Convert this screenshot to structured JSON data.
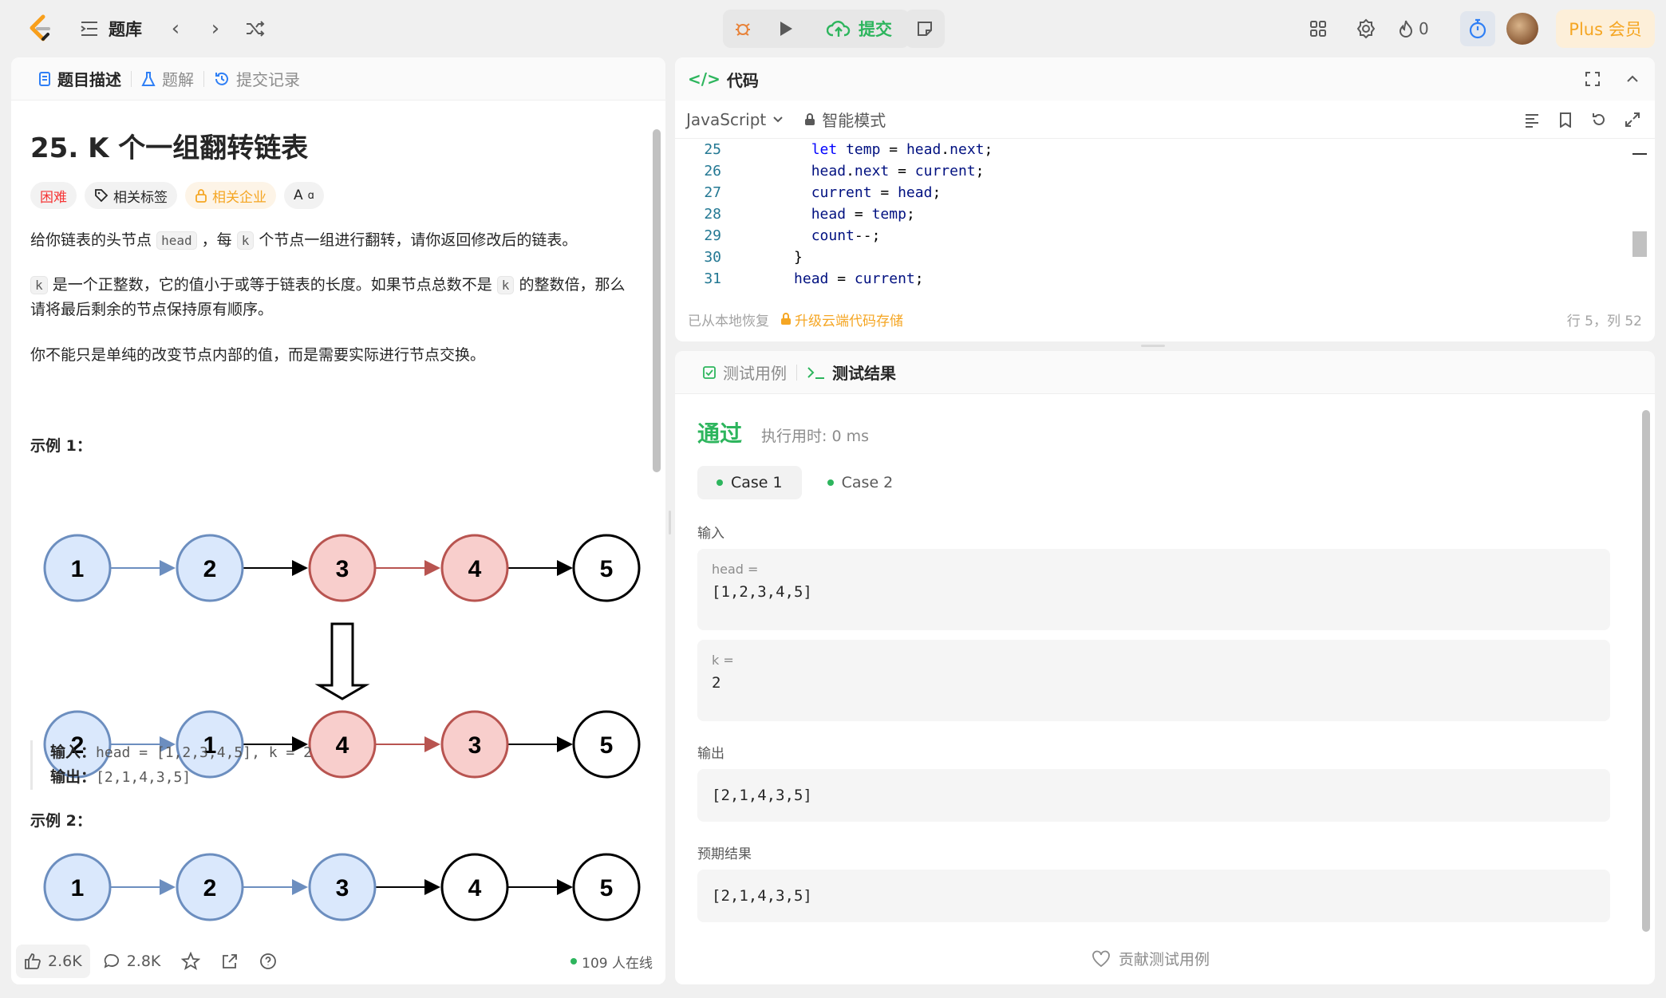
{
  "topbar": {
    "problem_list": "题库",
    "submit_label": "提交",
    "streak_count": "0",
    "plus_label": "Plus 会员"
  },
  "colors": {
    "accent_green": "#2db55d",
    "hard_red": "#f63636",
    "gold": "#f5a623"
  },
  "left": {
    "tabs": [
      "题目描述",
      "题解",
      "提交记录"
    ],
    "title": "25. K 个一组翻转链表",
    "tags": {
      "difficulty": "困难",
      "related_tags": "相关标签",
      "companies": "相关企业",
      "translate": "A"
    },
    "desc1_pre": "给你链表的头节点",
    "desc1_code1": "head",
    "desc1_mid": "，每",
    "desc1_code2": "k",
    "desc1_post": "个节点一组进行翻转，请你返回修改后的链表。",
    "desc2_code": "k",
    "desc2_a": "是一个正整数，它的值小于或等于链表的长度。如果节点总数不是",
    "desc2_code2": "k",
    "desc2_b": "的整数倍，那么请将最后剩余的节点保持原有顺序。",
    "desc3": "你不能只是单纯的改变节点内部的值，而是需要实际进行节点交换。",
    "example1_title": "示例 1：",
    "example1_input_label": "输入：",
    "example1_input": "head = [1,2,3,4,5], k = 2",
    "example1_output_label": "输出：",
    "example1_output": "[2,1,4,3,5]",
    "example2_title": "示例 2：",
    "diagram_row1": [
      "1",
      "2",
      "3",
      "4",
      "5"
    ],
    "diagram_row2": [
      "2",
      "1",
      "4",
      "3",
      "5"
    ],
    "diagram_row3": [
      "1",
      "2",
      "3",
      "4",
      "5"
    ],
    "footer": {
      "likes": "2.6K",
      "comments": "2.8K",
      "online": "109 人在线"
    }
  },
  "code": {
    "title": "代码",
    "language": "JavaScript",
    "mode": "智能模式",
    "lines": [
      {
        "n": "25",
        "indent": "        ",
        "tokens": [
          [
            "kw",
            "let"
          ],
          [
            "t",
            " "
          ],
          [
            "idt",
            "temp"
          ],
          [
            "t",
            " = "
          ],
          [
            "idt",
            "head"
          ],
          [
            "t",
            "."
          ],
          [
            "idt",
            "next"
          ],
          [
            "t",
            ";"
          ]
        ]
      },
      {
        "n": "26",
        "indent": "        ",
        "tokens": [
          [
            "idt",
            "head"
          ],
          [
            "t",
            "."
          ],
          [
            "idt",
            "next"
          ],
          [
            "t",
            " = "
          ],
          [
            "idt",
            "current"
          ],
          [
            "t",
            ";"
          ]
        ]
      },
      {
        "n": "27",
        "indent": "        ",
        "tokens": [
          [
            "idt",
            "current"
          ],
          [
            "t",
            " = "
          ],
          [
            "idt",
            "head"
          ],
          [
            "t",
            ";"
          ]
        ]
      },
      {
        "n": "28",
        "indent": "        ",
        "tokens": [
          [
            "idt",
            "head"
          ],
          [
            "t",
            " = "
          ],
          [
            "idt",
            "temp"
          ],
          [
            "t",
            ";"
          ]
        ]
      },
      {
        "n": "29",
        "indent": "        ",
        "tokens": [
          [
            "idt",
            "count"
          ],
          [
            "t",
            "--;"
          ]
        ]
      },
      {
        "n": "30",
        "indent": "      ",
        "tokens": [
          [
            "t",
            "}"
          ]
        ]
      },
      {
        "n": "31",
        "indent": "      ",
        "tokens": [
          [
            "idt",
            "head"
          ],
          [
            "t",
            " = "
          ],
          [
            "idt",
            "current"
          ],
          [
            "t",
            ";"
          ]
        ]
      }
    ],
    "restored": "已从本地恢复",
    "upgrade": "升级云端代码存储",
    "cursor": "行 5，列 52"
  },
  "test": {
    "tabs": [
      "测试用例",
      "测试结果"
    ],
    "status": "通过",
    "runtime": "执行用时: 0 ms",
    "cases": [
      "Case 1",
      "Case 2"
    ],
    "input_label": "输入",
    "head_label": "head =",
    "head_value": "[1,2,3,4,5]",
    "k_label": "k =",
    "k_value": "2",
    "output_label": "输出",
    "output_value": "[2,1,4,3,5]",
    "expected_label": "预期结果",
    "expected_value": "[2,1,4,3,5]",
    "contribute": "贡献测试用例"
  }
}
